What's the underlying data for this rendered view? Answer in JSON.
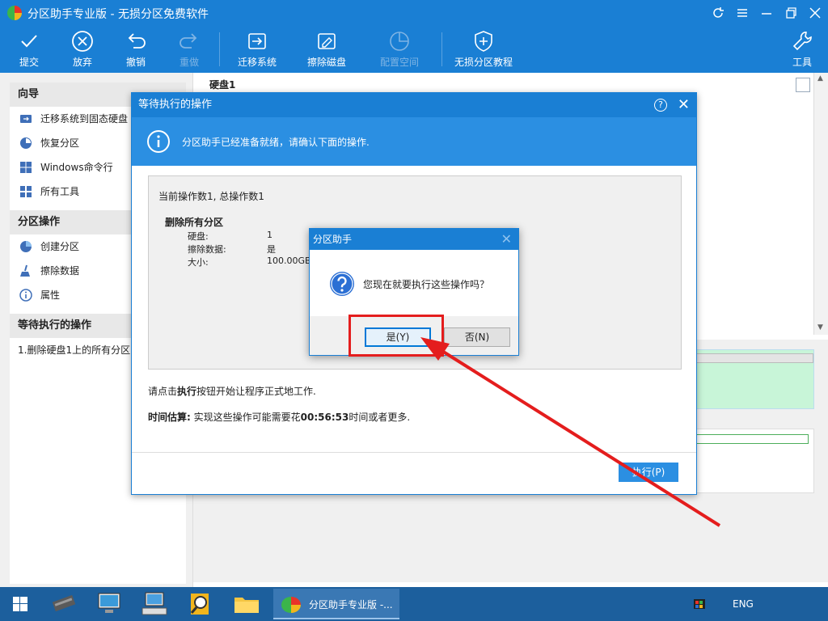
{
  "titlebar": {
    "title": "分区助手专业版 - 无损分区免费软件",
    "controls": [
      "refresh-icon",
      "menu-icon",
      "minimize-icon",
      "maximize-icon",
      "close-icon"
    ]
  },
  "toolbar": {
    "commit": "提交",
    "discard": "放弃",
    "undo": "撤销",
    "redo": "重做",
    "migrate": "迁移系统",
    "wipe": "擦除磁盘",
    "allocate": "配置空间",
    "tutorial": "无损分区教程",
    "tools": "工具"
  },
  "sidebar": {
    "wizard_head": "向导",
    "wizard_items": [
      "迁移系统到固态硬盘",
      "恢复分区",
      "Windows命令行",
      "所有工具"
    ],
    "ops_head": "分区操作",
    "ops_items": [
      "创建分区",
      "擦除数据",
      "属性"
    ],
    "pending_head": "等待执行的操作",
    "pending_item": "1.删除硬盘1上的所有分区"
  },
  "content": {
    "disk_label": "硬盘1"
  },
  "pending_dialog": {
    "title": "等待执行的操作",
    "banner": "分区助手已经准备就绪，请确认下面的操作.",
    "count_line": "当前操作数1, 总操作数1",
    "op_name": "删除所有分区",
    "details": [
      {
        "k": "硬盘:",
        "v": "1"
      },
      {
        "k": "擦除数据:",
        "v": "是"
      },
      {
        "k": "大小:",
        "v": "100.00GB"
      }
    ],
    "hint_pre": "请点击",
    "hint_bold": "执行",
    "hint_post": "按钮开始让程序正式地工作.",
    "time_label": "时间估算:",
    "time_pre": " 实现这些操作可能需要花",
    "time_value": "00:56:53",
    "time_post": "时间或者更多.",
    "execute": "执行(P)"
  },
  "confirm_dialog": {
    "title": "分区助手",
    "message": "您现在就要执行这些操作吗？",
    "yes": "是(Y)",
    "no": "否(N)"
  },
  "taskbar": {
    "active_app": "分区助手专业版 -...",
    "language": "ENG"
  },
  "colors": {
    "accent": "#1a7fd4",
    "banner": "#2b8fe2",
    "highlight": "#e41d1d",
    "taskbar": "#1c5f9d"
  }
}
